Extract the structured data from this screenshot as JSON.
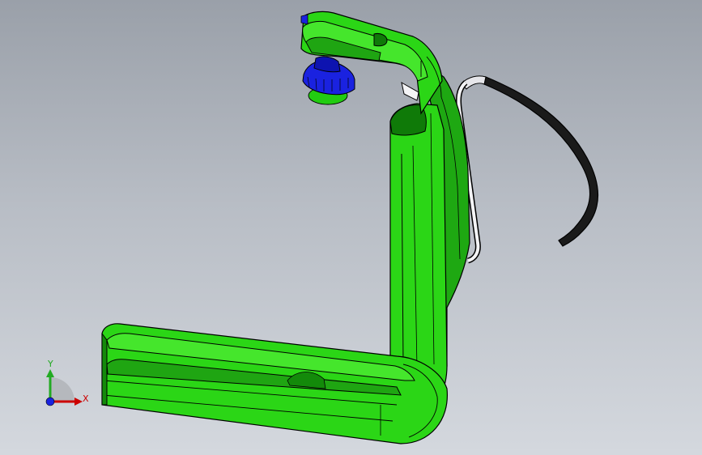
{
  "viewport": {
    "background_top": "#9aa0a9",
    "background_bottom": "#d4d8de"
  },
  "model": {
    "parts": [
      "bracket",
      "thumbscrew",
      "spring-clip"
    ],
    "colors": {
      "bracket": "#22cc11",
      "bracket_dark": "#0f7a08",
      "thumbscrew": "#1a22e0",
      "spring_clip": "#1a1a1a",
      "outline": "#000000"
    }
  },
  "triad": {
    "x_label": "X",
    "y_label": "Y",
    "x_color": "#cc0000",
    "y_color": "#22aa22",
    "z_color": "#1a22e0"
  }
}
